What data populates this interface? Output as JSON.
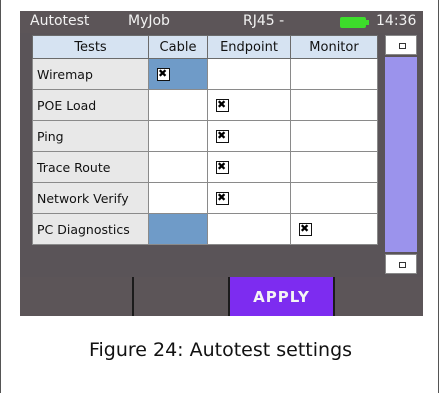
{
  "statusbar": {
    "app": "Autotest",
    "job": "MyJob",
    "port": "RJ45 -",
    "battery_icon": "battery-icon",
    "time": "14:36"
  },
  "table": {
    "headers": [
      "Tests",
      "Cable",
      "Endpoint",
      "Monitor"
    ],
    "rows": [
      {
        "name": "Wiremap",
        "cable": true,
        "endpoint": false,
        "monitor": false
      },
      {
        "name": "POE Load",
        "cable": false,
        "endpoint": true,
        "monitor": false
      },
      {
        "name": "Ping",
        "cable": false,
        "endpoint": true,
        "monitor": false
      },
      {
        "name": "Trace Route",
        "cable": false,
        "endpoint": true,
        "monitor": false
      },
      {
        "name": "Network Verify",
        "cable": false,
        "endpoint": true,
        "monitor": false
      },
      {
        "name": "PC Diagnostics",
        "cable": false,
        "endpoint": false,
        "monitor": true
      }
    ]
  },
  "colors": {
    "header_bg": "#d6e3f2",
    "selected_cell": "#6f9bc8",
    "scrollbar": "#9b93ec",
    "apply_button": "#7d2cf0",
    "battery": "#3ddc2b"
  },
  "softkeys": {
    "apply_label": "APPLY"
  },
  "caption": "Figure 24: Autotest settings"
}
